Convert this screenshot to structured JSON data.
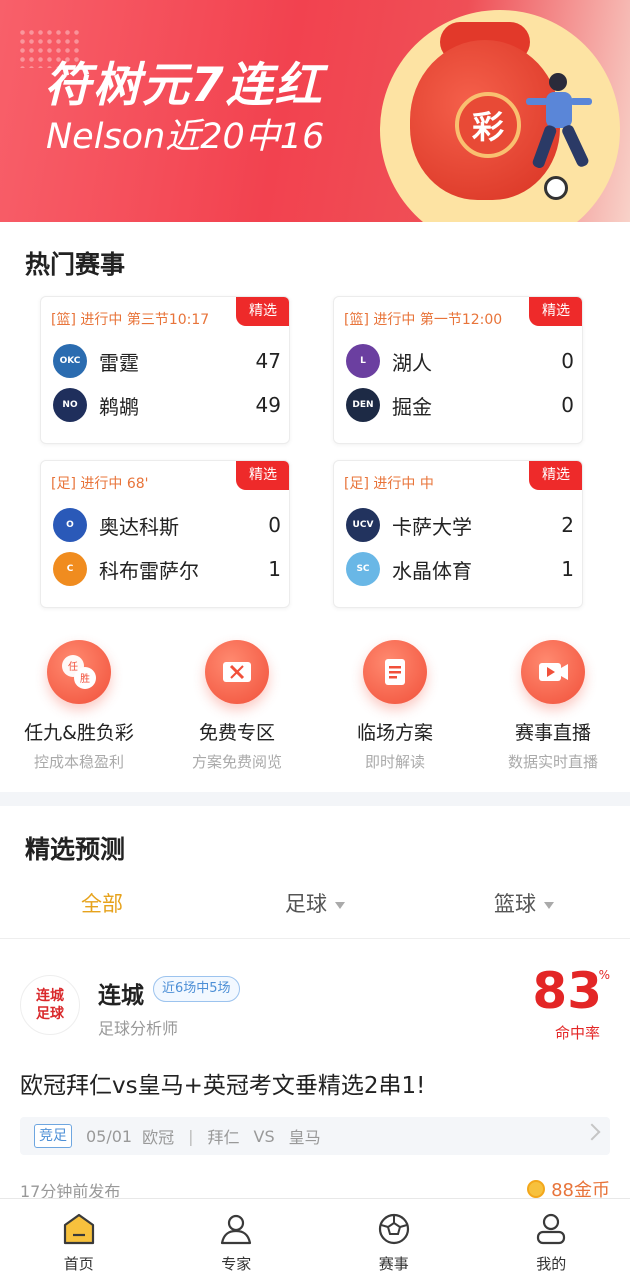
{
  "banner": {
    "headline": "符树元7连红",
    "subline": "Nelson近20中16",
    "coin_glyph": "彩"
  },
  "hot_games": {
    "title": "热门赛事",
    "badge_label": "精选",
    "cards": [
      {
        "status": "[篮]  进行中  第三节10:17",
        "teams": [
          {
            "name": "雷霆",
            "score": "47",
            "logo_color": "#2b6cb0",
            "logo_text": "OKC"
          },
          {
            "name": "鹈鹕",
            "score": "49",
            "logo_color": "#1f2f5c",
            "logo_text": "NO"
          }
        ]
      },
      {
        "status": "[篮]  进行中  第一节12:00",
        "teams": [
          {
            "name": "湖人",
            "score": "0",
            "logo_color": "#6b3fa0",
            "logo_text": "L"
          },
          {
            "name": "掘金",
            "score": "0",
            "logo_color": "#1d2a45",
            "logo_text": "DEN"
          }
        ]
      },
      {
        "status": "[足]  进行中  68'",
        "teams": [
          {
            "name": "奥达科斯",
            "score": "0",
            "logo_color": "#2a59b8",
            "logo_text": "O"
          },
          {
            "name": "科布雷萨尔",
            "score": "1",
            "logo_color": "#f08c1f",
            "logo_text": "C"
          }
        ]
      },
      {
        "status": "[足]  进行中  中",
        "teams": [
          {
            "name": "卡萨大学",
            "score": "2",
            "logo_color": "#22335e",
            "logo_text": "UCV"
          },
          {
            "name": "水晶体育",
            "score": "1",
            "logo_color": "#69b7e6",
            "logo_text": "SC"
          }
        ]
      }
    ]
  },
  "quick_entries": [
    {
      "title": "任九&胜负彩",
      "subtitle": "控成本稳盈利",
      "icon": "lottery-icon",
      "icon_text": "任胜"
    },
    {
      "title": "免费专区",
      "subtitle": "方案免费阅览",
      "icon": "ticket-icon",
      "icon_text": ""
    },
    {
      "title": "临场方案",
      "subtitle": "即时解读",
      "icon": "document-icon",
      "icon_text": ""
    },
    {
      "title": "赛事直播",
      "subtitle": "数据实时直播",
      "icon": "video-icon",
      "icon_text": ""
    }
  ],
  "predictions": {
    "title": "精选预测",
    "tabs": [
      {
        "label": "全部",
        "active": true
      },
      {
        "label": "足球",
        "active": false
      },
      {
        "label": "篮球",
        "active": false
      }
    ],
    "item": {
      "avatar_line1": "连城",
      "avatar_line2": "足球",
      "expert_name": "连城",
      "expert_tag": "近6场中5场",
      "expert_role": "足球分析师",
      "hit_rate": "83",
      "hit_unit": "%",
      "hit_label": "命中率",
      "headline": "欧冠拜仁vs皇马+英冠考文垂精选2串1!",
      "match_type": "竞足",
      "match_date": "05/01",
      "league": "欧冠",
      "home": "拜仁",
      "vs": "VS",
      "away": "皇马",
      "published": "17分钟前发布",
      "price": "88金币"
    }
  },
  "bottom_nav": [
    {
      "label": "首页",
      "icon": "home-icon",
      "active": true
    },
    {
      "label": "专家",
      "icon": "expert-icon",
      "active": false
    },
    {
      "label": "赛事",
      "icon": "ball-icon",
      "active": false
    },
    {
      "label": "我的",
      "icon": "profile-icon",
      "active": false
    }
  ],
  "colors": {
    "accent_red": "#ee2a2a",
    "accent_orange": "#e8743a",
    "tab_active": "#e6a21c",
    "tag_blue": "#4d8fd6"
  }
}
